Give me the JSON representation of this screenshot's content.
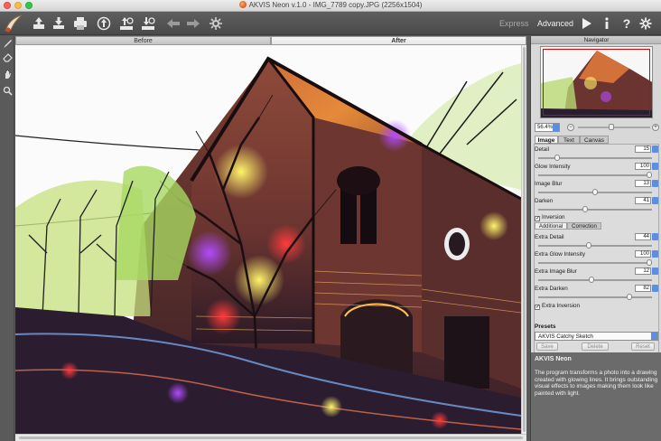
{
  "window": {
    "title": "AKVIS Neon v.1.0 - IMG_7789 copy.JPG (2256x1504)"
  },
  "toolbar": {
    "mode_express": "Express",
    "mode_advanced": "Advanced",
    "icons": [
      "open-icon",
      "save-icon",
      "print-icon",
      "share-icon",
      "batch-icon",
      "export-icon",
      "undo-icon",
      "redo-icon",
      "settings-icon",
      "run-icon",
      "info-icon",
      "help-icon",
      "preferences-icon"
    ]
  },
  "compare": {
    "before": "Before",
    "after": "After"
  },
  "navigator": {
    "title": "Navigator",
    "zoom": "56.4%"
  },
  "tabs": {
    "image": "Image",
    "text": "Text",
    "canvas": "Canvas"
  },
  "params": [
    {
      "label": "Detail",
      "value": "15",
      "level": 0.15
    },
    {
      "label": "Glow Intensity",
      "value": "100",
      "level": 1.0
    },
    {
      "label": "Image Blur",
      "value": "13",
      "level": 0.5
    },
    {
      "label": "Darken",
      "value": "41",
      "level": 0.41
    }
  ],
  "inversion": "Inversion",
  "subtabs": {
    "additional": "Additional",
    "correction": "Correction"
  },
  "extra_params": [
    {
      "label": "Extra Detail",
      "value": "44",
      "level": 0.44
    },
    {
      "label": "Extra Glow Intensity",
      "value": "100",
      "level": 1.0
    },
    {
      "label": "Extra Image Blur",
      "value": "12",
      "level": 0.47
    },
    {
      "label": "Extra Darken",
      "value": "82",
      "level": 0.82
    }
  ],
  "extra_inversion": "Extra Inversion",
  "presets": {
    "label": "Presets",
    "selected": "AKVIS Catchy Sketch",
    "save": "Save",
    "delete": "Delete",
    "reset": "Reset"
  },
  "info": {
    "title": "AKVIS Neon",
    "text": "The program transforms a photo into a drawing created with glowing lines. It brings outstanding visual effects to images making them look like painted with light."
  }
}
